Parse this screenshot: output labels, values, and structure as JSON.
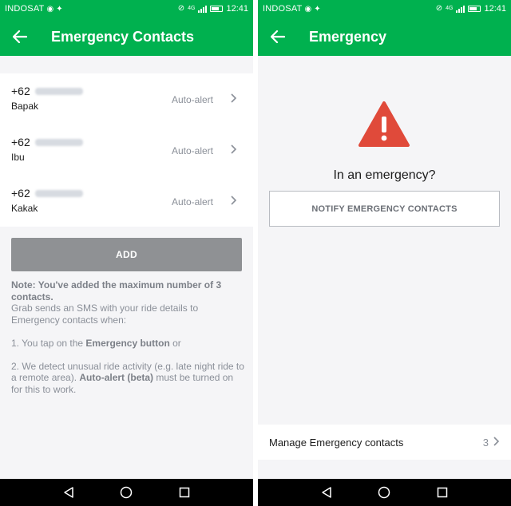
{
  "status_bar": {
    "carrier": "INDOSAT",
    "time": "12:41",
    "network_label": "4G"
  },
  "left_screen": {
    "title": "Emergency Contacts",
    "contacts": [
      {
        "prefix": "+62",
        "name": "Bapak",
        "status": "Auto-alert"
      },
      {
        "prefix": "+62",
        "name": "Ibu",
        "status": "Auto-alert"
      },
      {
        "prefix": "+62",
        "name": "Kakak",
        "status": "Auto-alert"
      }
    ],
    "add_label": "ADD",
    "note": {
      "lead": "Note: You've added the maximum number of 3 contacts.",
      "intro": "Grab sends an SMS with your ride details to Emergency contacts when:",
      "point1_pre": "1. You tap on the ",
      "point1_bold": "Emergency button",
      "point1_post": " or",
      "point2_pre": "2. We detect unusual ride activity (e.g. late night ride to a remote area). ",
      "point2_bold": "Auto-alert (beta)",
      "point2_post": " must be turned on for this to work."
    }
  },
  "right_screen": {
    "title": "Emergency",
    "question": "In an emergency?",
    "notify_label": "NOTIFY EMERGENCY CONTACTS",
    "manage_label": "Manage Emergency contacts",
    "manage_count": "3"
  },
  "icons": {
    "back": "arrow-left-icon",
    "warning": "warning-triangle-icon",
    "chevron": "chevron-right-icon",
    "nav_back": "triangle-back-icon",
    "nav_home": "circle-home-icon",
    "nav_recents": "square-recents-icon"
  },
  "colors": {
    "brand_green": "#00b14f",
    "warning_red": "#e04a3a",
    "disabled_button": "#8f9194"
  }
}
